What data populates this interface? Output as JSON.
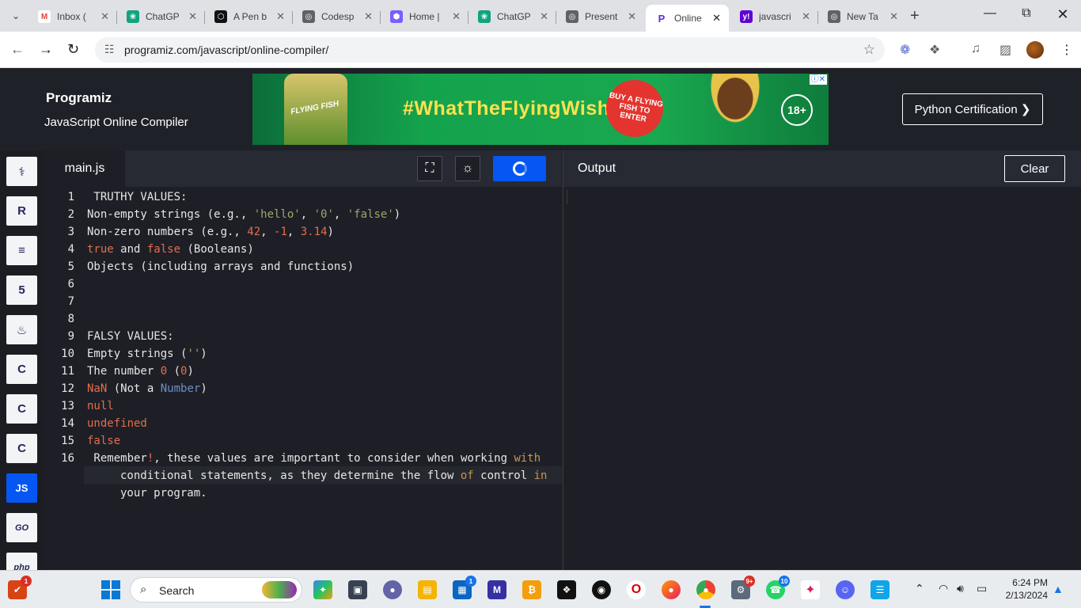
{
  "browser": {
    "tabs": [
      {
        "label": "Inbox (",
        "favicon": "gmail-icon",
        "color": "#ea4335"
      },
      {
        "label": "ChatGP",
        "favicon": "chatgpt-icon",
        "color": "#10a37f"
      },
      {
        "label": "A Pen b",
        "favicon": "codepen-icon",
        "color": "#111111"
      },
      {
        "label": "Codesp",
        "favicon": "globe-icon",
        "color": "#5f6368"
      },
      {
        "label": "Home |",
        "favicon": "home-icon",
        "color": "#7b5cff"
      },
      {
        "label": "ChatGP",
        "favicon": "chatgpt-icon",
        "color": "#10a37f"
      },
      {
        "label": "Present",
        "favicon": "globe-icon",
        "color": "#5f6368"
      },
      {
        "label": "Online",
        "favicon": "programiz-icon",
        "color": "#5e33d1",
        "active": true
      },
      {
        "label": "javascri",
        "favicon": "yahoo-icon",
        "color": "#6001d2"
      },
      {
        "label": "New Ta",
        "favicon": "globe-icon",
        "color": "#5f6368"
      }
    ],
    "url": "programiz.com/javascript/online-compiler/"
  },
  "header": {
    "logo": "Programiz",
    "subtitle": "JavaScript Online Compiler",
    "ad_hashtag": "#WhatTheFlyingWish",
    "ad_badge": "BUY A FLYING FISH TO ENTER",
    "ad_brand": "FLYING FISH",
    "ad_age": "18+",
    "cert_button": "Python Certification ❯"
  },
  "languages": [
    {
      "name": "python-icon",
      "glyph": "⚕"
    },
    {
      "name": "r-icon",
      "glyph": "R"
    },
    {
      "name": "sql-icon",
      "glyph": "≡"
    },
    {
      "name": "html5-icon",
      "glyph": "5"
    },
    {
      "name": "java-icon",
      "glyph": "♨"
    },
    {
      "name": "c-icon",
      "glyph": "C"
    },
    {
      "name": "cpp-icon",
      "glyph": "C"
    },
    {
      "name": "csharp-icon",
      "glyph": "C"
    },
    {
      "name": "js-icon",
      "glyph": "JS",
      "active": true
    },
    {
      "name": "go-icon",
      "glyph": "GO"
    },
    {
      "name": "php-icon",
      "glyph": "php"
    }
  ],
  "editor": {
    "file_tab": "main.js",
    "lines": [
      {
        "num": "1"
      },
      {
        "num": "2"
      },
      {
        "num": "3"
      },
      {
        "num": "4"
      },
      {
        "num": "5"
      },
      {
        "num": "6"
      },
      {
        "num": "7"
      },
      {
        "num": "8"
      },
      {
        "num": "9"
      },
      {
        "num": "10"
      },
      {
        "num": "11"
      },
      {
        "num": "12"
      },
      {
        "num": "13"
      },
      {
        "num": "14"
      },
      {
        "num": "15"
      },
      {
        "num": "16"
      }
    ],
    "code": {
      "l1": " TRUTHY VALUES:",
      "l2a": "Non-empty strings (e.g., ",
      "l2b": "'hello'",
      "l2c": ", ",
      "l2d": "'0'",
      "l2e": ", ",
      "l2f": "'false'",
      "l2g": ")",
      "l3a": "Non-zero numbers (e.g., ",
      "l3b": "42",
      "l3c": ", ",
      "l3d": "-1",
      "l3e": ", ",
      "l3f": "3.14",
      "l3g": ")",
      "l4a": "true",
      "l4b": " and ",
      "l4c": "false",
      "l4d": " (Booleans)",
      "l5": "Objects (including arrays and functions)",
      "l9": "FALSY VALUES:",
      "l10a": "Empty strings (",
      "l10b": "''",
      "l10c": ")",
      "l11a": "The number ",
      "l11b": "0",
      "l11c": " (",
      "l11d": "0",
      "l11e": ")",
      "l12a": "NaN",
      "l12b": " (Not a ",
      "l12c": "Number",
      "l12d": ")",
      "l13": "null",
      "l14": "undefined",
      "l15": "false",
      "l16a": " Remember",
      "l16b": "!",
      "l16c": ", these values are important to consider when working ",
      "l16d": "with",
      "l16e": "conditional statements, as they determine the flow ",
      "l16f": "of",
      "l16g": " control ",
      "l16h": "in",
      "l16i": "your program."
    }
  },
  "output": {
    "title": "Output",
    "clear_button": "Clear"
  },
  "taskbar": {
    "search_placeholder": "Search",
    "time": "6:24 PM",
    "date": "2/13/2024",
    "badges": {
      "first": "1",
      "store": "1",
      "teams": "9+",
      "whatsapp": "10"
    }
  }
}
